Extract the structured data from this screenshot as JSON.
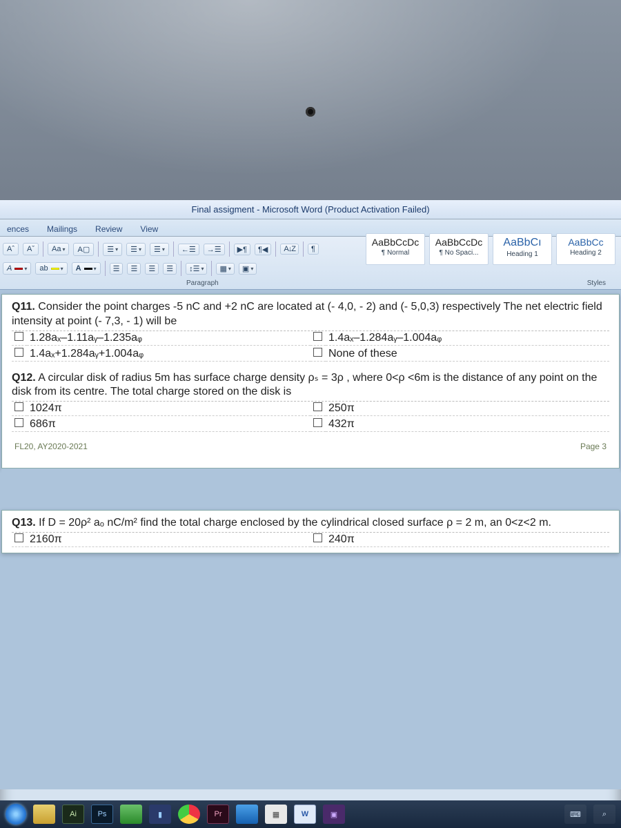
{
  "window": {
    "title": "Final assigment  -  Microsoft Word (Product Activation Failed)"
  },
  "tabs": {
    "t1": "ences",
    "t2": "Mailings",
    "t3": "Review",
    "t4": "View"
  },
  "ribbon": {
    "grow": "Aˆ",
    "shrink": "Aˇ",
    "case": "Aa",
    "clear": "A▢",
    "bullets": "☰",
    "numbering": "☰",
    "multilevel": "☰",
    "dec_indent": "←☰",
    "inc_indent": "→☰",
    "ltr": "▶¶",
    "rtl": "¶◀",
    "sort_label": "A↓Z",
    "show_marks": "¶",
    "highlight": "ab",
    "font_color": "A",
    "align_l": "☰",
    "align_c": "☰",
    "align_r": "☰",
    "align_j": "☰",
    "linespace": "↕☰",
    "shading": "▦",
    "borders": "▣",
    "paragraph_label": "Paragraph",
    "styles_label": "Styles"
  },
  "styles": {
    "s1": {
      "sample": "AaBbCcDc",
      "name": "¶ Normal"
    },
    "s2": {
      "sample": "AaBbCcDc",
      "name": "¶ No Spaci..."
    },
    "s3": {
      "sample": "AaBbCı",
      "name": "Heading 1"
    },
    "s4": {
      "sample": "AaBbCc",
      "name": "Heading 2"
    }
  },
  "doc": {
    "q11_title": "Q11.",
    "q11_body": " Consider the point charges -5 nC and +2 nC are located at (- 4,0, - 2) and (- 5,0,3) respectively The net electric field intensity at point (- 7,3, - 1) will be",
    "q11_a": "1.28aₓ–1.11aᵧ–1.235aᵩ",
    "q11_b": "1.4aₓ–1.284aᵧ–1.004aᵩ",
    "q11_c": "1.4aₓ+1.284aᵧ+1.004aᵩ",
    "q11_d": "None of these",
    "q12_title": "Q12.",
    "q12_body": " A circular disk of radius 5m has surface charge density ρₛ = 3ρ , where  0<ρ <6m is the distance of any point on the disk from its centre. The total charge stored on the disk is",
    "q12_a": "1024π",
    "q12_b": "250π",
    "q12_c": "686π",
    "q12_d": "432π",
    "footer_left": "FL20, AY2020-2021",
    "footer_right": "Page 3",
    "q13_title": "Q13.",
    "q13_body": " If D = 20ρ² aₒ nC/m² find the total charge enclosed by the cylindrical closed surface ρ = 2 m, an 0<z<2 m.",
    "q13_a": "2160π",
    "q13_b": "240π"
  },
  "taskbar": {
    "ai": "Ai",
    "ps": "Ps",
    "pr": "Pr",
    "w": "W"
  }
}
